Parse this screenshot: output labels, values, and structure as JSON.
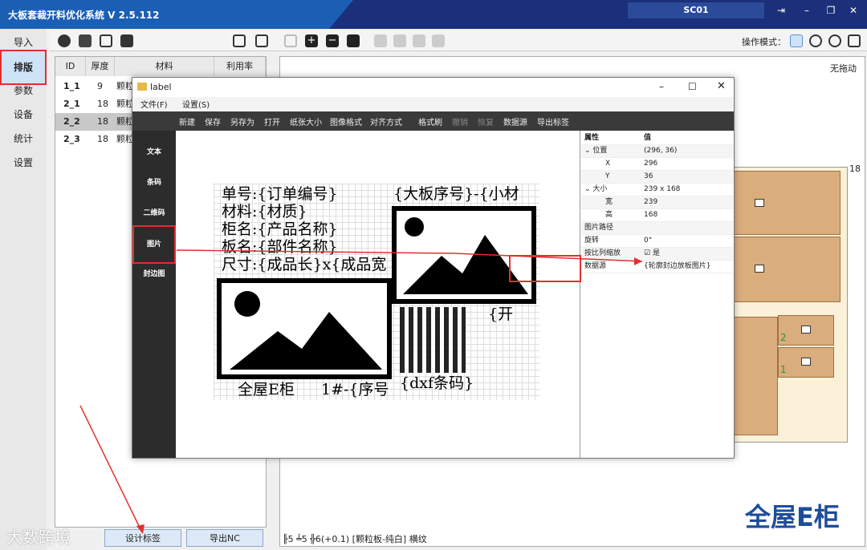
{
  "app": {
    "title": "大板套裁开料优化系统  V 2.5.112",
    "user_tab": "SC01"
  },
  "nav": {
    "items": [
      "导入",
      "排版",
      "参数",
      "设备",
      "统计",
      "设置"
    ]
  },
  "toolbar": {
    "mode_label": "操作模式："
  },
  "table": {
    "headers": [
      "ID",
      "厚度",
      "材料",
      "利用率"
    ],
    "rows": [
      {
        "id": "1_1",
        "thick": "9",
        "material": "颗粒"
      },
      {
        "id": "2_1",
        "thick": "18",
        "material": "颗粒"
      },
      {
        "id": "2_2",
        "thick": "18",
        "material": "颗粒"
      },
      {
        "id": "2_3",
        "thick": "18",
        "material": "颗粒"
      }
    ]
  },
  "canvas": {
    "nodrag": "无拖动",
    "sheet_number": "18",
    "part_numbers": [
      "2",
      "1"
    ]
  },
  "status": {
    "text": "╟5 ╧5  ╬6(+0.1)  [颗粒板-纯白]  横纹"
  },
  "brand": "全屋E柜",
  "bottom": {
    "design_label": "设计标签",
    "export_label": "导出NC"
  },
  "watermark": "大数跨境",
  "label_window": {
    "title": "label",
    "menu": [
      "文件(F)",
      "设置(S)"
    ],
    "tools": [
      "新建",
      "保存",
      "另存为",
      "打开",
      "纸张大小",
      "图像格式",
      "对齐方式",
      "格式刷",
      "撤销",
      "恢复",
      "数据源",
      "导出标签"
    ],
    "side": [
      "文本",
      "条码",
      "二维码",
      "图片",
      "封边图"
    ],
    "lines": {
      "l1": "单号:{订单编号}",
      "l2": "材料:{材质}",
      "l3": "柜名:{产品名称}",
      "l4": "板名:{部件名称}",
      "l5": "尺寸:{成品长}x{成品宽",
      "r1": "{大板序号}-{小材",
      "open": "{开",
      "b1": "全屋E柜",
      "b2": "1#-{序号",
      "b3": "{dxf条码}"
    },
    "props": {
      "head_k": "属性",
      "head_v": "值",
      "pos_k": "位置",
      "pos_v": "(296, 36)",
      "x_k": "X",
      "x_v": "296",
      "y_k": "Y",
      "y_v": "36",
      "size_k": "大小",
      "size_v": "239 x 168",
      "w_k": "宽",
      "w_v": "239",
      "h_k": "高",
      "h_v": "168",
      "path_k": "图片路径",
      "path_v": "",
      "rot_k": "旋转",
      "rot_v": "0°",
      "scale_k": "按比列缩放",
      "scale_v": "是",
      "src_k": "数据源",
      "src_v": "{轮廓封边放板图片}"
    }
  },
  "colors": {
    "titlebar": "#1a5fb4",
    "accent_red": "#e03030",
    "brand_blue": "#1d4d9b"
  }
}
